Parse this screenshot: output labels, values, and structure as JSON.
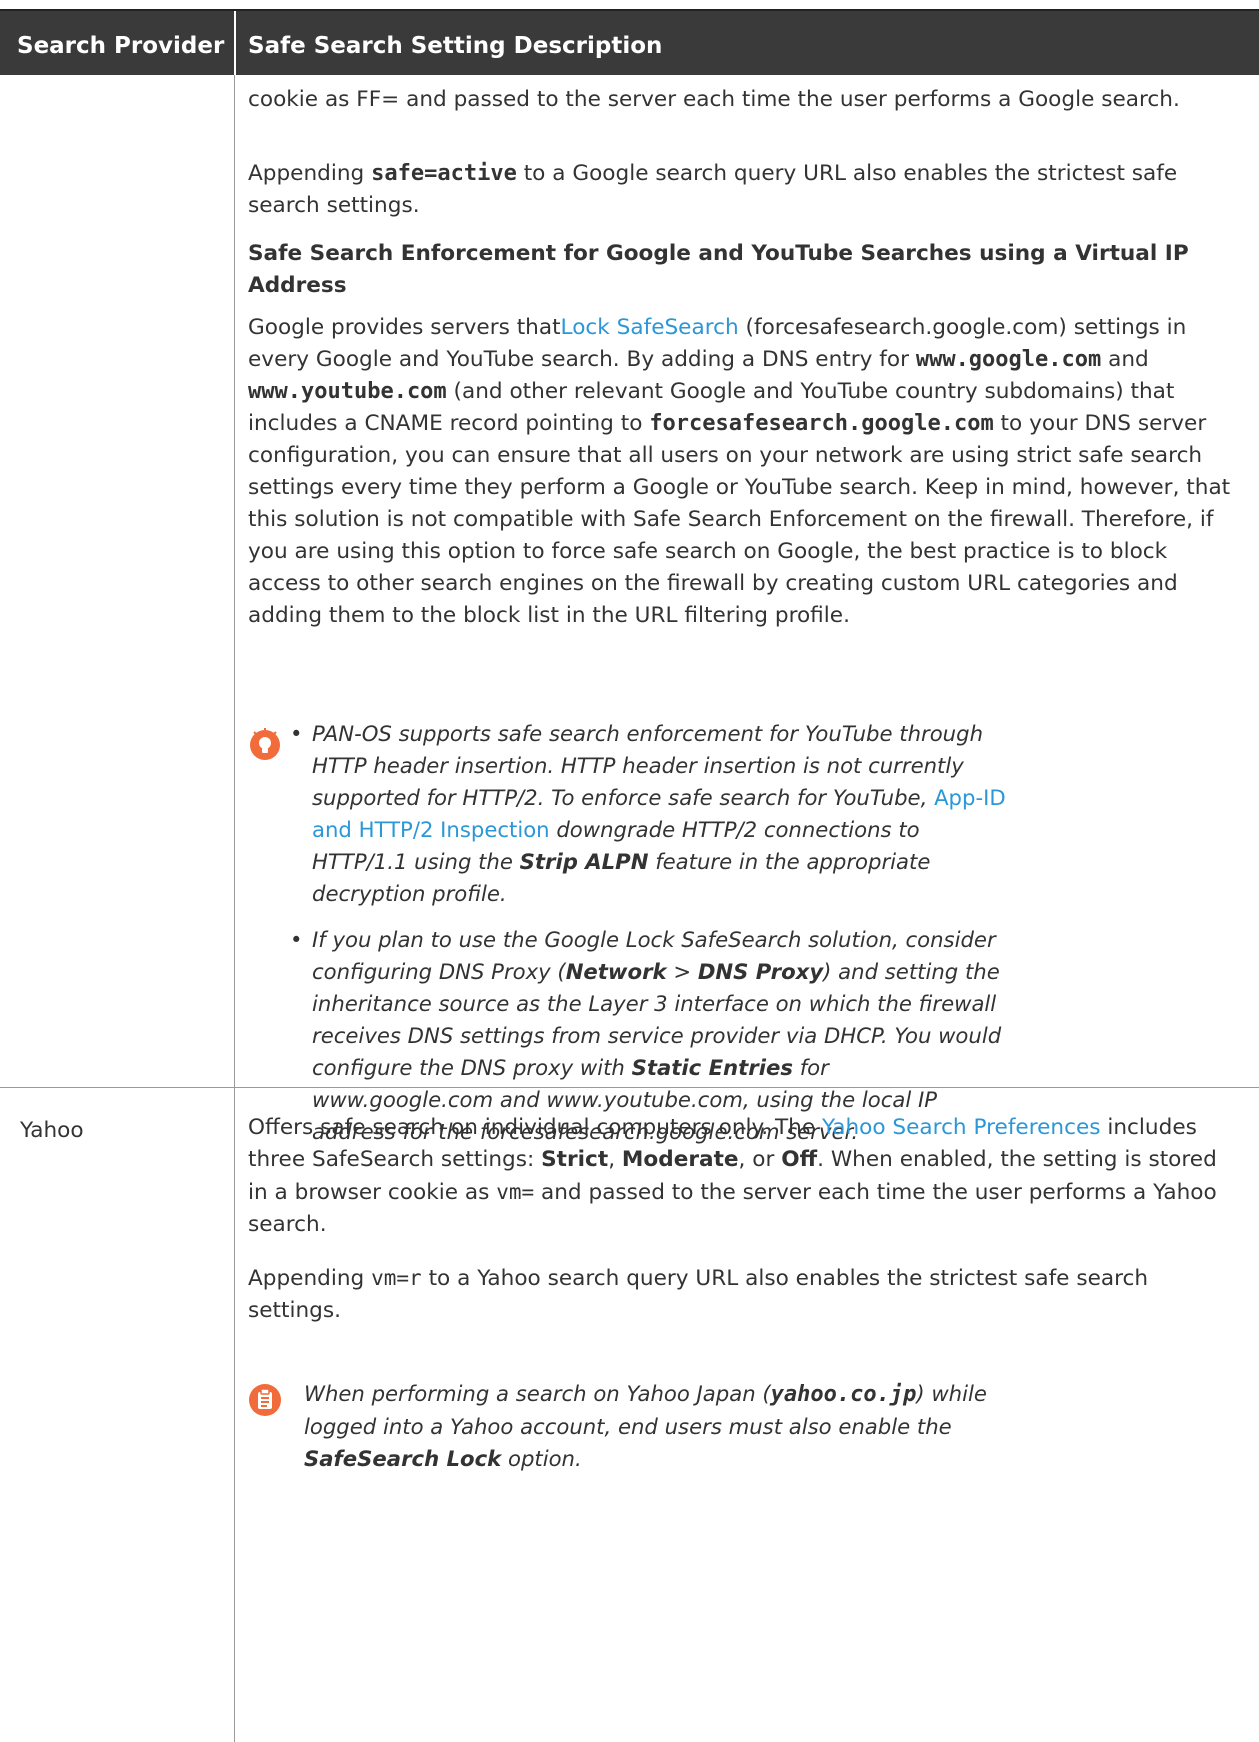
{
  "table": {
    "headers": [
      "Search Provider",
      "Safe Search Setting Description"
    ]
  },
  "google": {
    "p1": "cookie as FF= and passed to the server each time the user performs a Google search.",
    "p2_pre": "Appending ",
    "p2_code": "safe=active",
    "p2_post": " to a Google search query URL also enables the strictest safe search settings.",
    "heading": "Safe Search Enforcement for Google and YouTube Searches using a Virtual IP Address",
    "p3_a": "Google provides servers that",
    "p3_link": "Lock SafeSearch",
    "p3_b": " (forcesafesearch.google.com) settings in every Google and YouTube search. By adding a DNS entry for ",
    "p3_code1": "www.google.com",
    "p3_c": " and ",
    "p3_code2": "www.youtube.com",
    "p3_d": " (and other relevant Google and YouTube country subdomains) that includes a CNAME record pointing to ",
    "p3_code3": "forcesafesearch.google.com",
    "p3_e": " to your DNS server configuration, you can ensure that all users on your network are using strict safe search settings every time they perform a Google or YouTube search. Keep in mind, however, that this solution is not compatible with Safe Search Enforcement on the firewall. Therefore, if you are using this option to force safe search on Google, the best practice is to block access to other search engines on the firewall by creating custom URL categories and adding them to the block list in the URL filtering profile.",
    "note1_a": "PAN-OS supports safe search enforcement for YouTube through HTTP header insertion. HTTP header insertion is not currently supported for HTTP/2. To enforce safe search for YouTube, ",
    "note1_link": "App-ID and HTTP/2 Inspection",
    "note1_b": " downgrade HTTP/2 connections to HTTP/1.1 using the ",
    "note1_bold": "Strip ALPN",
    "note1_c": " feature in the appropriate decryption profile.",
    "note2_a": "If you plan to use the Google Lock SafeSearch solution, consider configuring DNS Proxy (",
    "note2_b1": "Network",
    "note2_sep": " > ",
    "note2_b2": "DNS Proxy",
    "note2_b": ") and setting the inheritance source as the Layer 3 interface on which the firewall receives DNS settings from service provider via DHCP. You would configure the DNS proxy with ",
    "note2_b3": "Static Entries",
    "note2_c": " for www.google.com and www.youtube.com, using the local IP address for the forcesafesearch.google.com server."
  },
  "yahoo": {
    "provider": "Yahoo",
    "p1_a": "Offers safe search on individual computers only. The ",
    "p1_link": "Yahoo Search Preferences",
    "p1_b": " includes three SafeSearch settings: ",
    "strict": "Strict",
    "comma1": ", ",
    "moderate": "Moderate",
    "or": ", or ",
    "off": "Off",
    "p1_c": ". When enabled, the setting is stored in a browser cookie as ",
    "p1_code": "vm=",
    "p1_d": " and passed to the server each time the user performs a Yahoo search.",
    "p2_pre": "Appending ",
    "p2_code": "vm=r",
    "p2_post": " to a Yahoo search query URL also enables the strictest safe search settings.",
    "note_a": "When performing a search on Yahoo Japan (",
    "note_code": "yahoo.co.jp",
    "note_b": ") while logged into a Yahoo account, end users must also enable the ",
    "note_bold": "SafeSearch Lock",
    "note_c": " option."
  },
  "colors": {
    "header_bg": "#3a3a3a",
    "link": "#2b97d6",
    "icon": "#f26b3a"
  }
}
